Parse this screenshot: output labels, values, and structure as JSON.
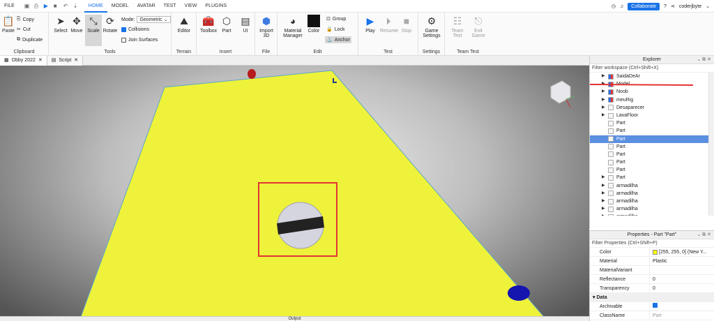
{
  "menu": {
    "file": "FILE",
    "tabs": [
      "HOME",
      "MODEL",
      "AVATAR",
      "TEST",
      "VIEW",
      "PLUGINS"
    ],
    "collaborate": "Collaborate",
    "user": "coderjbyte"
  },
  "ribbon": {
    "clipboard": {
      "label": "Clipboard",
      "paste": "Paste",
      "copy": "Copy",
      "cut": "Cut",
      "duplicate": "Duplicate"
    },
    "tools": {
      "label": "Tools",
      "select": "Select",
      "move": "Move",
      "scale": "Scale",
      "rotate": "Rotate",
      "mode_label": "Mode:",
      "mode_value": "Geometric",
      "collisions": "Collisions",
      "join": "Join Surfaces"
    },
    "terrain": {
      "label": "Terrain",
      "editor": "Editor"
    },
    "insert": {
      "label": "Insert",
      "toolbox": "Toolbox",
      "part": "Part",
      "ui": "UI"
    },
    "file": {
      "label": "File",
      "import": "Import 3D"
    },
    "edit": {
      "label": "Edit",
      "material": "Material Manager",
      "color": "Color",
      "group": "Group",
      "lock": "Lock",
      "anchor": "Anchor"
    },
    "test": {
      "label": "Test",
      "play": "Play",
      "resume": "Resume",
      "stop": "Stop"
    },
    "settings": {
      "label": "Settings",
      "game": "Game Settings"
    },
    "teamtest": {
      "label": "Team Test",
      "team": "Team Test",
      "exit": "Exit Game"
    }
  },
  "doc_tabs": [
    "Obby 2022",
    "Script"
  ],
  "explorer": {
    "title": "Explorer",
    "filter": "Filter workspace (Ctrl+Shift+X)",
    "items": [
      {
        "label": "SaidaDeAr",
        "type": "model",
        "arrow": true
      },
      {
        "label": "Model",
        "type": "model",
        "arrow": true
      },
      {
        "label": "Noob",
        "type": "model",
        "arrow": true
      },
      {
        "label": "meuRig",
        "type": "model",
        "arrow": true
      },
      {
        "label": "Desaparecer",
        "type": "part",
        "arrow": true
      },
      {
        "label": "LavaFloor",
        "type": "part",
        "arrow": true
      },
      {
        "label": "Part",
        "type": "part",
        "arrow": false
      },
      {
        "label": "Part",
        "type": "part",
        "arrow": false
      },
      {
        "label": "Part",
        "type": "part",
        "arrow": false,
        "selected": true
      },
      {
        "label": "Part",
        "type": "part",
        "arrow": false
      },
      {
        "label": "Part",
        "type": "part",
        "arrow": false
      },
      {
        "label": "Part",
        "type": "part",
        "arrow": false
      },
      {
        "label": "Part",
        "type": "part",
        "arrow": false
      },
      {
        "label": "Part",
        "type": "part",
        "arrow": true
      },
      {
        "label": "armadilha",
        "type": "part",
        "arrow": true
      },
      {
        "label": "armadilha",
        "type": "part",
        "arrow": true
      },
      {
        "label": "armadilha",
        "type": "part",
        "arrow": true
      },
      {
        "label": "armadilha",
        "type": "part",
        "arrow": true
      },
      {
        "label": "armadilha",
        "type": "part",
        "arrow": true
      }
    ]
  },
  "properties": {
    "title": "Properties - Part \"Part\"",
    "filter": "Filter Properties (Ctrl+Shift+P)",
    "rows": [
      {
        "key": "Color",
        "value": "[255, 255, 0] (New Y...",
        "swatch": true
      },
      {
        "key": "Material",
        "value": "Plastic"
      },
      {
        "key": "MaterialVariant",
        "value": ""
      },
      {
        "key": "Reflectance",
        "value": "0"
      },
      {
        "key": "Transparency",
        "value": "0"
      }
    ],
    "data_cat": "Data",
    "data_rows": [
      {
        "key": "Archivable",
        "value": ""
      },
      {
        "key": "ClassName",
        "value": "Part"
      }
    ]
  },
  "output_label": "Output",
  "colors": {
    "accent": "#1a73e8",
    "baseplate": "#eef23a",
    "highlight": "#e23333"
  }
}
